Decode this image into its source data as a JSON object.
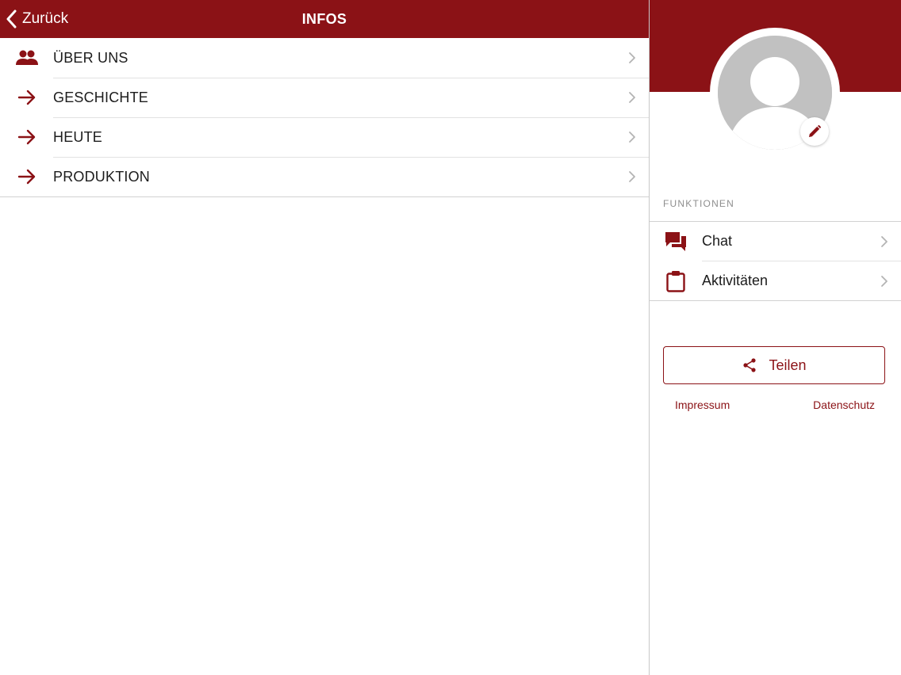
{
  "colors": {
    "brand": "#8b1216",
    "avatar_placeholder": "#c1c1c1"
  },
  "navbar": {
    "back_label": "Zurück",
    "back_icon": "chevron-left-icon",
    "title": "INFOS"
  },
  "menu": {
    "items": [
      {
        "label": "ÜBER UNS",
        "icon": "people-icon"
      },
      {
        "label": "GESCHICHTE",
        "icon": "arrow-right-icon"
      },
      {
        "label": "HEUTE",
        "icon": "arrow-right-icon"
      },
      {
        "label": "PRODUKTION",
        "icon": "arrow-right-icon"
      }
    ]
  },
  "profile": {
    "avatar_icon": "person-silhouette-icon",
    "edit_icon": "pencil-icon"
  },
  "functions": {
    "section_title": "FUNKTIONEN",
    "items": [
      {
        "label": "Chat",
        "icon": "chat-icon"
      },
      {
        "label": "Aktivitäten",
        "icon": "clipboard-icon"
      }
    ]
  },
  "share": {
    "label": "Teilen",
    "icon": "share-icon"
  },
  "footer": {
    "impressum": "Impressum",
    "datenschutz": "Datenschutz"
  }
}
